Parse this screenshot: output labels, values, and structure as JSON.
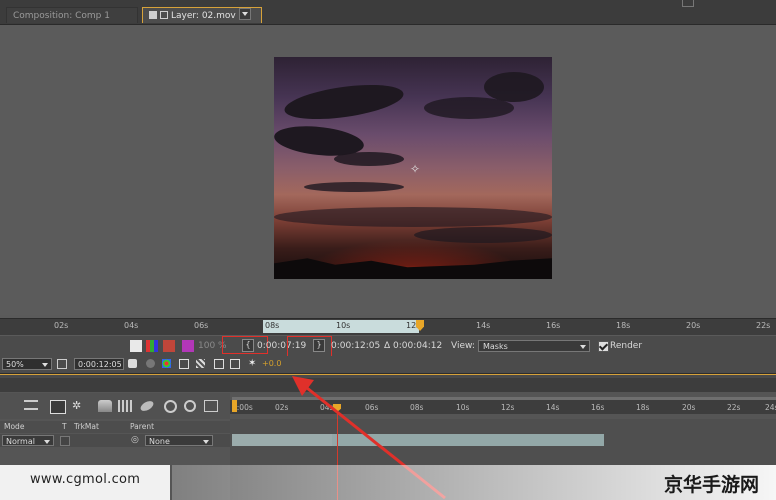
{
  "tabs": {
    "composition": "Composition: Comp 1",
    "layer": "Layer: 02.mov"
  },
  "time_ruler": {
    "ticks": [
      "02s",
      "04s",
      "06s",
      "08s",
      "10s",
      "12s",
      "14s",
      "16s",
      "18s",
      "20s",
      "22s"
    ]
  },
  "controls": {
    "in_time": "0:00:07:19",
    "out_time": "0:00:12:05",
    "duration": "Δ 0:00:04:12",
    "view_label": "View:",
    "view_value": "Masks",
    "render_label": "Render",
    "opacity_text": "100 %",
    "set_in_glyph": "{",
    "set_out_glyph": "}"
  },
  "control_bar2": {
    "zoom": "50%",
    "timecode": "0:00:12:05",
    "exposure": "+0.0"
  },
  "timeline": {
    "ticks": [
      "0:00s",
      "02s",
      "04s",
      "06s",
      "08s",
      "10s",
      "12s",
      "14s",
      "16s",
      "18s",
      "20s",
      "22s",
      "24s"
    ],
    "columns": {
      "mode": "Mode",
      "t": "T",
      "trkmat": "TrkMat",
      "parent": "Parent"
    },
    "layer": {
      "mode": "Normal",
      "parent": "None"
    }
  },
  "watermark": {
    "left": "www.cgmol.com",
    "right": "京华手游网"
  },
  "colors": {
    "accent": "#e8a628",
    "highlight_red": "#e0302a",
    "work_area": "#c9dcdc",
    "layer_bar": "#93a8a8"
  }
}
